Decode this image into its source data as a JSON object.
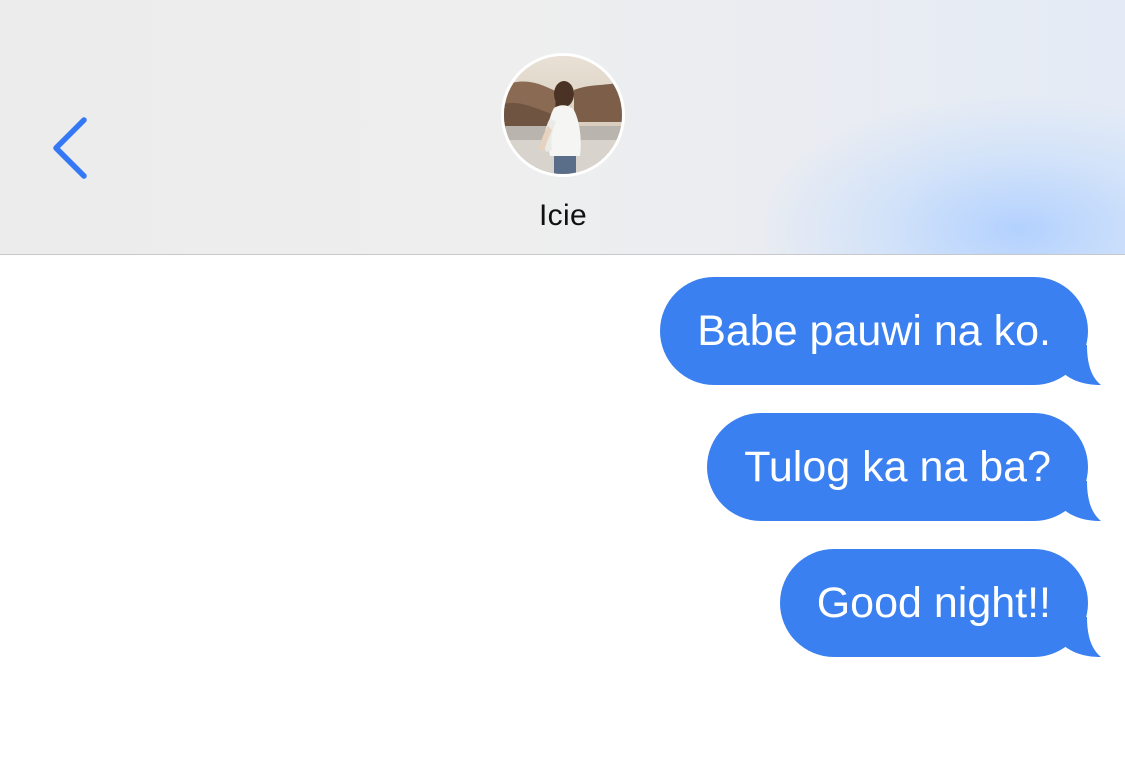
{
  "header": {
    "back_icon": "chevron-left-icon",
    "contact_name": "Icie",
    "avatar_description": "profile photo"
  },
  "colors": {
    "accent": "#3478f6",
    "bubble": "#3b80f0",
    "bubble_text": "#ffffff",
    "name_text": "#111111"
  },
  "messages": [
    {
      "text": "Babe pauwi na ko.",
      "sender": "me"
    },
    {
      "text": "Tulog ka na ba?",
      "sender": "me"
    },
    {
      "text": "Good night!!",
      "sender": "me"
    }
  ]
}
